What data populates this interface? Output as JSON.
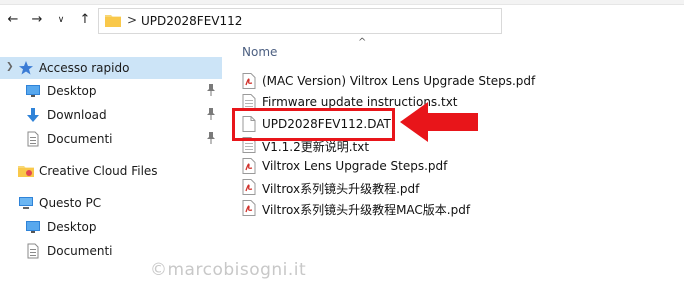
{
  "address_bar": {
    "back_label": "←",
    "forward_label": "→",
    "recent_label": "∨",
    "up_label": "↑",
    "separator": ">",
    "path": "UPD2028FEV112"
  },
  "sidebar": {
    "quick_access": "Accesso rapido",
    "quick_items": [
      {
        "label": "Desktop",
        "icon": "desktop-icon",
        "pinned": true
      },
      {
        "label": "Download",
        "icon": "download-icon",
        "pinned": true
      },
      {
        "label": "Documenti",
        "icon": "documents-icon",
        "pinned": true
      }
    ],
    "creative_cloud": "Creative Cloud Files",
    "this_pc": "Questo PC",
    "pc_items": [
      {
        "label": "Desktop",
        "icon": "desktop-icon"
      },
      {
        "label": "Documenti",
        "icon": "documents-icon"
      }
    ]
  },
  "file_list": {
    "column_header": "Nome",
    "files": [
      {
        "name": "(MAC Version) Viltrox Lens Upgrade Steps.pdf",
        "type": "pdf"
      },
      {
        "name": "Firmware update instructions.txt",
        "type": "txt"
      },
      {
        "name": "UPD2028FEV112.DAT",
        "type": "dat",
        "highlighted": true
      },
      {
        "name": "V1.1.2更新说明.txt",
        "type": "txt"
      },
      {
        "name": "Viltrox Lens Upgrade Steps.pdf",
        "type": "pdf"
      },
      {
        "name": "Viltrox系列镜头升级教程.pdf",
        "type": "pdf"
      },
      {
        "name": "Viltrox系列镜头升级教程MAC版本.pdf",
        "type": "pdf"
      }
    ]
  },
  "watermark": "©marcobisogni.it",
  "colors": {
    "selection": "#cce4f7",
    "highlight_red": "#e8151a",
    "folder_yellow": "#f8d775",
    "pdf_red": "#d0302a"
  }
}
